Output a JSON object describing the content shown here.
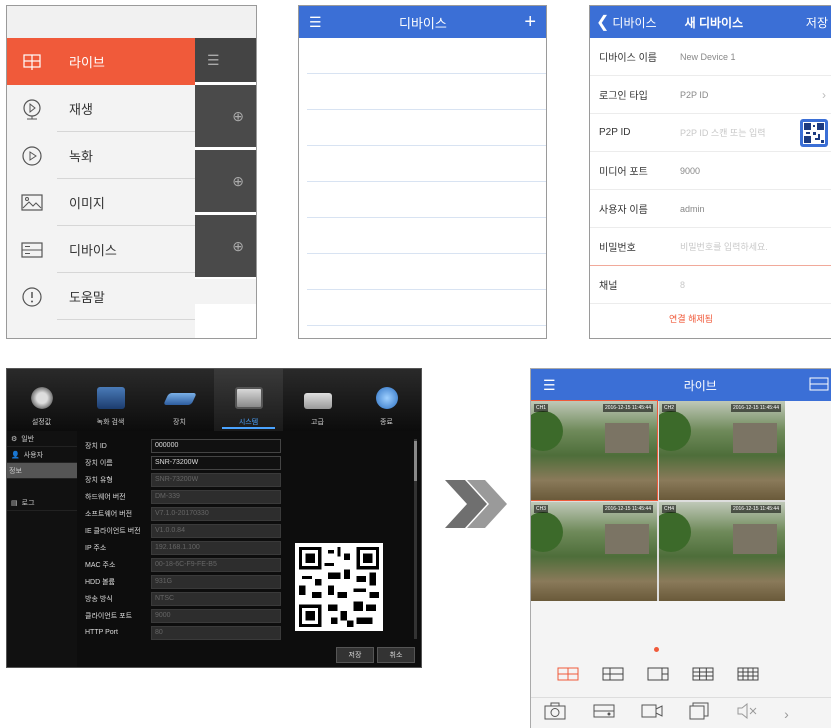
{
  "panel1": {
    "menu": [
      {
        "label": "라이브",
        "icon": "live-grid-icon",
        "active": true
      },
      {
        "label": "재생",
        "icon": "playback-icon"
      },
      {
        "label": "녹화",
        "icon": "record-icon"
      },
      {
        "label": "이미지",
        "icon": "image-icon"
      },
      {
        "label": "디바이스",
        "icon": "device-icon"
      },
      {
        "label": "도움말",
        "icon": "help-icon"
      }
    ]
  },
  "panel2": {
    "title": "디바이스",
    "add": "+",
    "menu": "☰"
  },
  "panel3": {
    "back_label": "디바이스",
    "title": "새 디바이스",
    "save": "저장",
    "rows": [
      {
        "key": "디바이스 이름",
        "value": "New Device 1",
        "placeholder": false
      },
      {
        "key": "로그인 타입",
        "value": "P2P ID",
        "placeholder": false
      },
      {
        "key": "P2P ID",
        "value": "P2P ID 스캔 또는 입력",
        "placeholder": true
      },
      {
        "key": "미디어 포트",
        "value": "9000",
        "placeholder": false
      },
      {
        "key": "사용자 이름",
        "value": "admin",
        "placeholder": false
      },
      {
        "key": "비밀번호",
        "value": "비밀번호를 입력하세요.",
        "placeholder": true
      },
      {
        "key": "채널",
        "value": "8",
        "placeholder": true
      }
    ],
    "status": "연결 해제됨"
  },
  "panel4": {
    "tabs": [
      "설정값",
      "녹화 검색",
      "장치",
      "시스템",
      "고급",
      "종료"
    ],
    "active_tab": "시스템",
    "left_menu": [
      "일반",
      "사용자",
      "정보",
      "로그"
    ],
    "left_selected": "정보",
    "fields": [
      {
        "key": "장치 ID",
        "value": "000000",
        "editable": true
      },
      {
        "key": "장치 이름",
        "value": "SNR-73200W",
        "editable": true
      },
      {
        "key": "장치 유형",
        "value": "SNR-73200W",
        "editable": false
      },
      {
        "key": "하드웨어 버전",
        "value": "DM-339",
        "editable": false
      },
      {
        "key": "소프트웨어 버전",
        "value": "V7.1.0-20170330",
        "editable": false
      },
      {
        "key": "IE 클라이언트 버전",
        "value": "V1.0.0.84",
        "editable": false
      },
      {
        "key": "IP 주소",
        "value": "192.168.1.100",
        "editable": false
      },
      {
        "key": "MAC 주소",
        "value": "00-18-6C-F9-FE-B5",
        "editable": false
      },
      {
        "key": "HDD 볼륨",
        "value": "931G",
        "editable": false
      },
      {
        "key": "방송 방식",
        "value": "NTSC",
        "editable": false
      },
      {
        "key": "클라이언트 포트",
        "value": "9000",
        "editable": false
      },
      {
        "key": "HTTP Port",
        "value": "80",
        "editable": false
      }
    ],
    "save": "저장",
    "cancel": "취소"
  },
  "panel5": {
    "title": "라이브",
    "cameras": [
      {
        "channel": "CH1",
        "timestamp": "2016-12-15 11:45:44"
      },
      {
        "channel": "CH2",
        "timestamp": "2016-12-15 11:45:44"
      },
      {
        "channel": "CH3",
        "timestamp": "2016-12-15 11:45:44"
      },
      {
        "channel": "CH4",
        "timestamp": "2016-12-15 11:45:44"
      }
    ],
    "more": "›"
  },
  "colors": {
    "accent": "#f05a3a",
    "header_blue": "#3b6fd6",
    "dvr_bg": "#0d0d0d"
  }
}
